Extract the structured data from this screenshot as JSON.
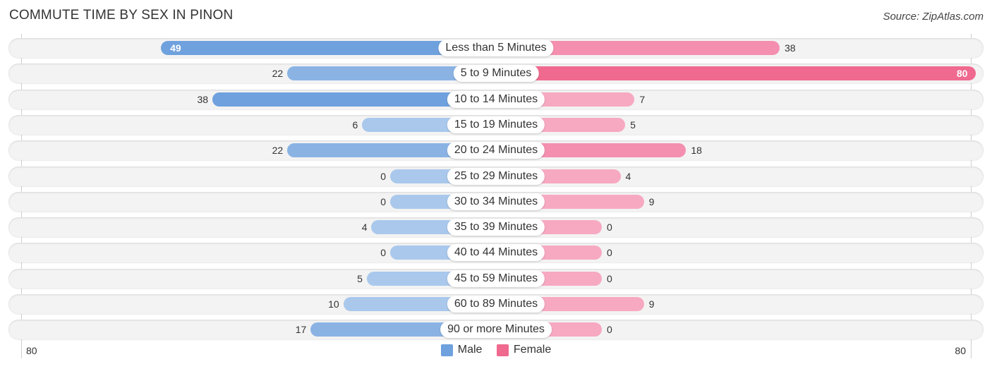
{
  "title": "COMMUTE TIME BY SEX IN PINON",
  "source": "Source: ZipAtlas.com",
  "colors": {
    "male": "#6ea1dd",
    "male_light": "#a9c8ec",
    "female": "#f0698f",
    "female_light": "#f7a9c1"
  },
  "chart_data": {
    "type": "bar",
    "orientation": "horizontal-diverging",
    "title": "COMMUTE TIME BY SEX IN PINON",
    "categories": [
      "Less than 5 Minutes",
      "5 to 9 Minutes",
      "10 to 14 Minutes",
      "15 to 19 Minutes",
      "20 to 24 Minutes",
      "25 to 29 Minutes",
      "30 to 34 Minutes",
      "35 to 39 Minutes",
      "40 to 44 Minutes",
      "45 to 59 Minutes",
      "60 to 89 Minutes",
      "90 or more Minutes"
    ],
    "series": [
      {
        "name": "Male",
        "values": [
          49,
          22,
          38,
          6,
          22,
          0,
          0,
          4,
          0,
          5,
          10,
          17
        ]
      },
      {
        "name": "Female",
        "values": [
          38,
          80,
          7,
          5,
          18,
          4,
          9,
          0,
          0,
          0,
          9,
          0
        ]
      }
    ],
    "axis": {
      "left_label": "80",
      "right_label": "80",
      "max": 80
    },
    "legend": {
      "position": "bottom-center",
      "items": [
        "Male",
        "Female"
      ]
    }
  }
}
